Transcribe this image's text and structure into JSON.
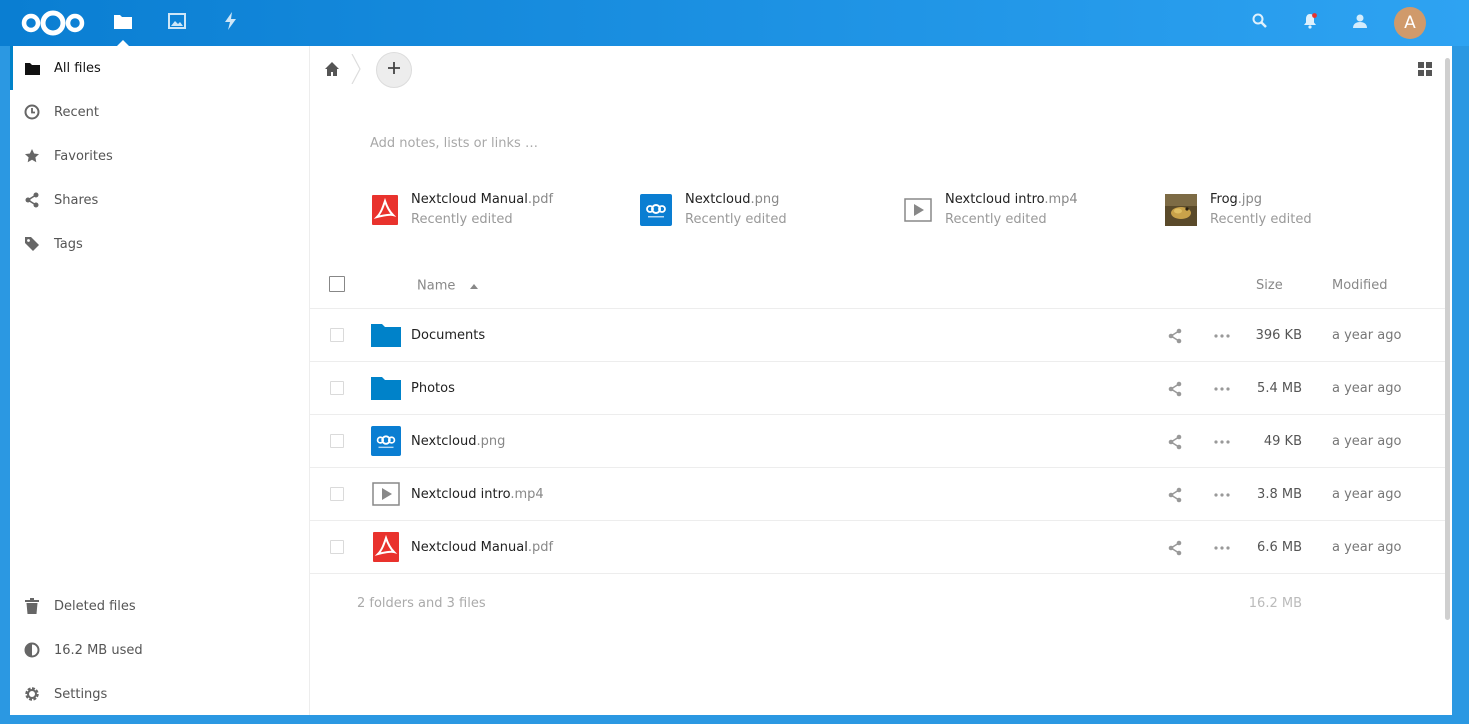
{
  "header": {
    "user_initial": "A",
    "accent": "#0082c9"
  },
  "sidebar": {
    "items": [
      {
        "label": "All files",
        "icon": "folder-icon"
      },
      {
        "label": "Recent",
        "icon": "clock-icon"
      },
      {
        "label": "Favorites",
        "icon": "star-icon"
      },
      {
        "label": "Shares",
        "icon": "share-icon"
      },
      {
        "label": "Tags",
        "icon": "tag-icon"
      }
    ],
    "bottom": [
      {
        "label": "Deleted files",
        "icon": "trash-icon"
      },
      {
        "label": "16.2 MB used",
        "icon": "quota-pie-icon"
      },
      {
        "label": "Settings",
        "icon": "gear-icon"
      }
    ]
  },
  "main": {
    "notes_placeholder": "Add notes, lists or links …",
    "recent": [
      {
        "base": "Nextcloud Manual",
        "ext": ".pdf",
        "status": "Recently edited",
        "icon": "pdf-icon"
      },
      {
        "base": "Nextcloud",
        "ext": ".png",
        "status": "Recently edited",
        "icon": "nextcloud-image-icon"
      },
      {
        "base": "Nextcloud intro",
        "ext": ".mp4",
        "status": "Recently edited",
        "icon": "video-icon"
      },
      {
        "base": "Frog",
        "ext": ".jpg",
        "status": "Recently edited",
        "icon": "photo-thumbnail-icon"
      }
    ],
    "table": {
      "col_name": "Name",
      "col_size": "Size",
      "col_modified": "Modified",
      "rows": [
        {
          "base": "Documents",
          "ext": "",
          "size": "396 KB",
          "modified": "a year ago",
          "icon": "folder-icon"
        },
        {
          "base": "Photos",
          "ext": "",
          "size": "5.4 MB",
          "modified": "a year ago",
          "icon": "folder-icon"
        },
        {
          "base": "Nextcloud",
          "ext": ".png",
          "size": "49 KB",
          "modified": "a year ago",
          "icon": "nextcloud-image-icon"
        },
        {
          "base": "Nextcloud intro",
          "ext": ".mp4",
          "size": "3.8 MB",
          "modified": "a year ago",
          "icon": "video-icon"
        },
        {
          "base": "Nextcloud Manual",
          "ext": ".pdf",
          "size": "6.6 MB",
          "modified": "a year ago",
          "icon": "pdf-icon"
        }
      ],
      "summary": "2 folders and 3 files",
      "summary_size": "16.2 MB"
    }
  }
}
